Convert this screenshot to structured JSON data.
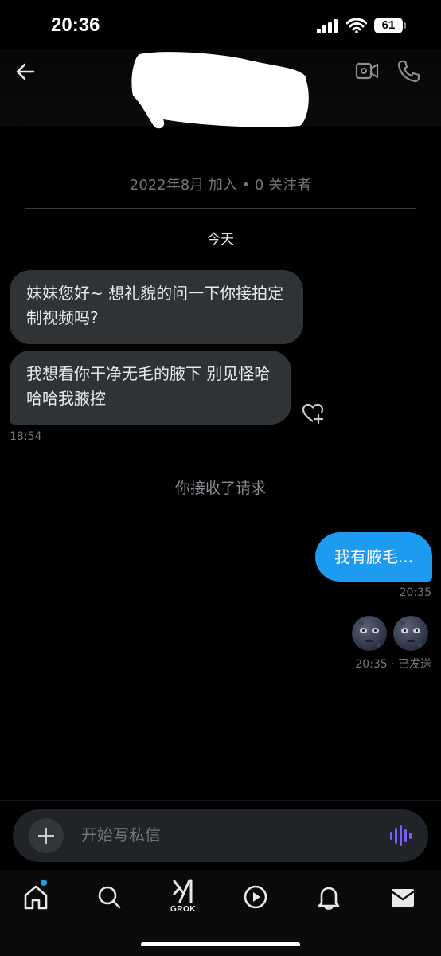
{
  "status_bar": {
    "time": "20:36",
    "battery": "61"
  },
  "header": {
    "contact_name_redacted": true
  },
  "profile": {
    "meta": "2022年8月 加入 • 0 关注者"
  },
  "conversation": {
    "date_separator": "今天",
    "incoming": [
      {
        "text": "妹妹您好~ 想礼貌的问一下你接拍定制视频吗?"
      },
      {
        "text": "我想看你干净无毛的腋下 别见怪哈哈哈我腋控"
      }
    ],
    "incoming_time": "18:54",
    "system_note": "你接收了请求",
    "outgoing": [
      {
        "text": "我有腋毛..."
      }
    ],
    "outgoing_time": "20:35",
    "emoji_names": [
      "new-moon-face-emoji",
      "new-moon-face-emoji"
    ],
    "emoji_status": "20:35 · 已发送"
  },
  "composer": {
    "placeholder": "开始写私信"
  },
  "tabbar": {
    "grok_label": "GROK",
    "tabs": [
      "home-icon",
      "search-icon",
      "grok-icon",
      "video-icon",
      "notifications-icon",
      "messages-icon"
    ]
  },
  "colors": {
    "accent": "#1d9bf0",
    "bubble_in": "#2f3336",
    "voice": "#7c5cff"
  }
}
